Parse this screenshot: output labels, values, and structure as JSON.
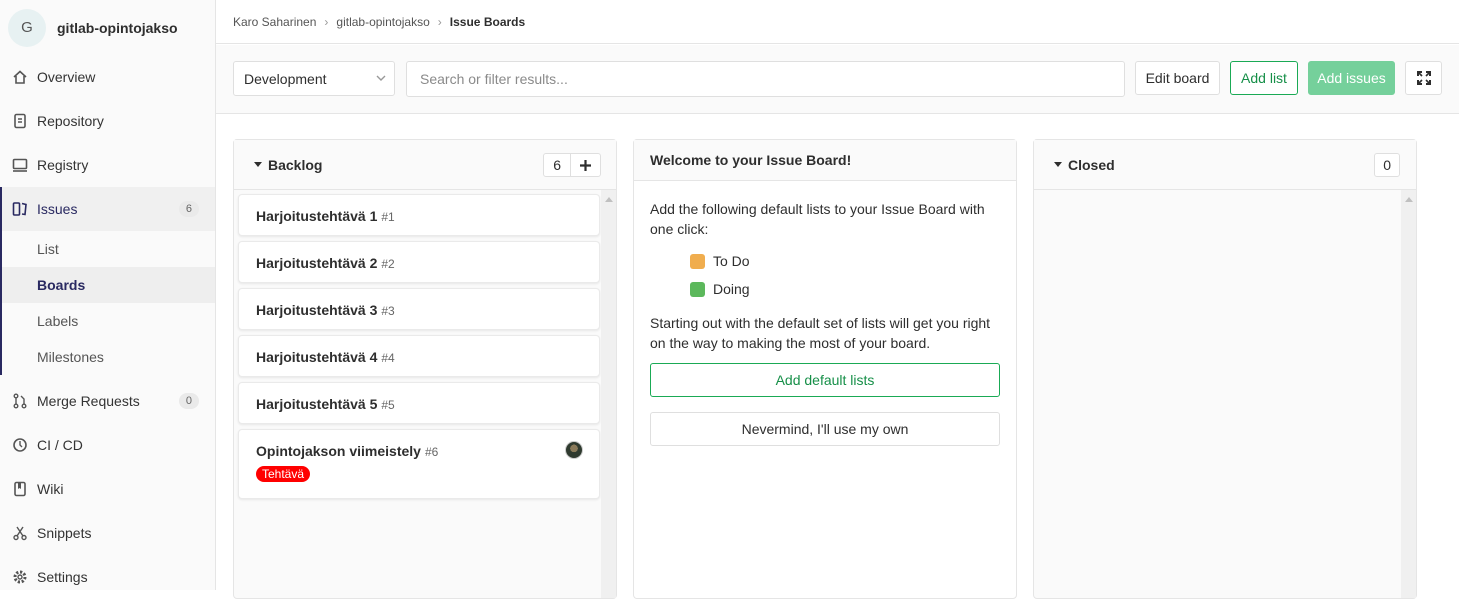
{
  "sidebar": {
    "project_initial": "G",
    "project_name": "gitlab-opintojakso",
    "items": [
      {
        "label": "Overview"
      },
      {
        "label": "Repository"
      },
      {
        "label": "Registry"
      },
      {
        "label": "Issues",
        "badge": "6"
      },
      {
        "label": "Merge Requests",
        "badge": "0"
      },
      {
        "label": "CI / CD"
      },
      {
        "label": "Wiki"
      },
      {
        "label": "Snippets"
      },
      {
        "label": "Settings"
      }
    ],
    "issues_sub": [
      {
        "label": "List"
      },
      {
        "label": "Boards"
      },
      {
        "label": "Labels"
      },
      {
        "label": "Milestones"
      }
    ]
  },
  "breadcrumb": {
    "user": "Karo Saharinen",
    "project": "gitlab-opintojakso",
    "current": "Issue Boards"
  },
  "filterbar": {
    "board_select": "Development",
    "search_placeholder": "Search or filter results...",
    "edit_board": "Edit board",
    "add_list": "Add list",
    "add_issues": "Add issues"
  },
  "backlog": {
    "title": "Backlog",
    "count": "6",
    "cards": [
      {
        "title": "Harjoitustehtävä 1",
        "iid": "#1"
      },
      {
        "title": "Harjoitustehtävä 2",
        "iid": "#2"
      },
      {
        "title": "Harjoitustehtävä 3",
        "iid": "#3"
      },
      {
        "title": "Harjoitustehtävä 4",
        "iid": "#4"
      },
      {
        "title": "Harjoitustehtävä 5",
        "iid": "#5"
      },
      {
        "title": "Opintojakson viimeistely",
        "iid": "#6",
        "label": "Tehtävä",
        "label_color": "#ff0000"
      }
    ]
  },
  "welcome": {
    "title": "Welcome to your Issue Board!",
    "intro": "Add the following default lists to your Issue Board with one click:",
    "lists": [
      {
        "name": "To Do",
        "color": "#f0ad4e"
      },
      {
        "name": "Doing",
        "color": "#5cb85c"
      }
    ],
    "outro": "Starting out with the default set of lists will get you right on the way to making the most of your board.",
    "add_default": "Add default lists",
    "nevermind": "Nevermind, I'll use my own"
  },
  "closed": {
    "title": "Closed",
    "count": "0"
  },
  "colors": {
    "accent_green": "#1aaa55",
    "active_nav": "#292961"
  }
}
